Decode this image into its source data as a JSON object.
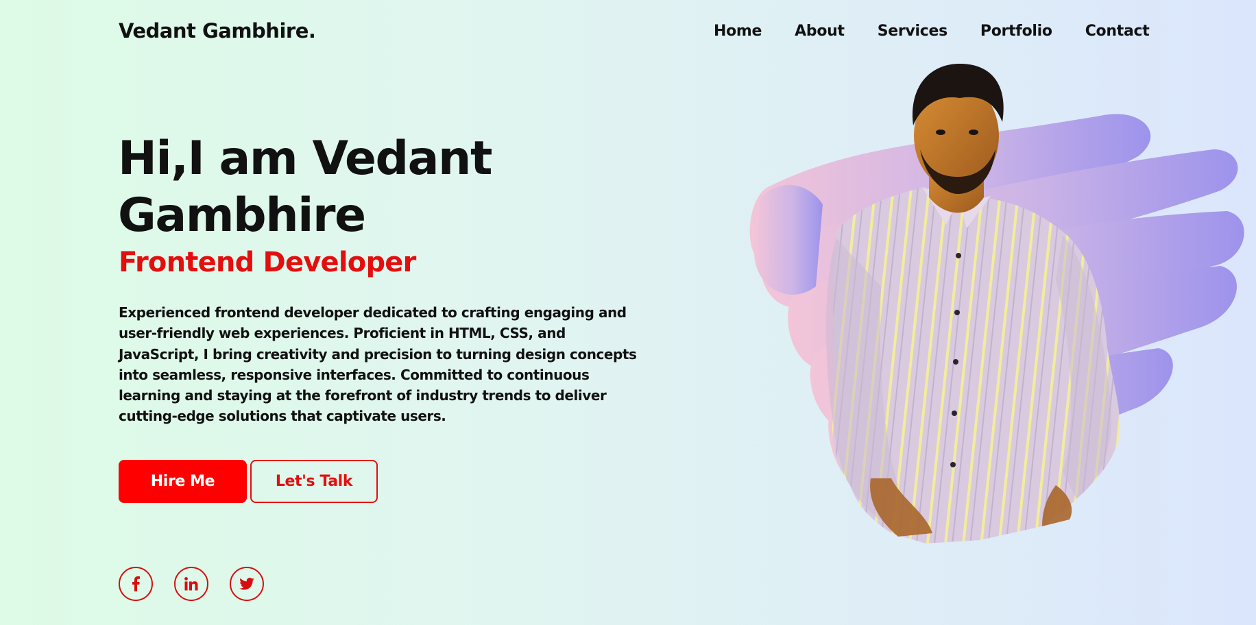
{
  "header": {
    "logo": "Vedant Gambhire.",
    "nav": [
      "Home",
      "About",
      "Services",
      "Portfolio",
      "Contact"
    ]
  },
  "hero": {
    "title": "Hi,I am Vedant Gambhire",
    "role": "Frontend Developer",
    "description": "Experienced frontend developer dedicated to crafting engaging and user-friendly web experiences. Proficient in HTML, CSS, and JavaScript, I bring creativity and precision to turning design concepts into seamless, responsive interfaces. Committed to continuous learning and staying at the forefront of industry trends to deliver cutting-edge solutions that captivate users.",
    "hire_button": "Hire Me",
    "talk_button": "Let's Talk"
  },
  "socials": [
    {
      "icon": "facebook-icon"
    },
    {
      "icon": "linkedin-icon"
    },
    {
      "icon": "twitter-icon"
    }
  ],
  "colors": {
    "accent": "#fe0000",
    "accent_text": "#e40e0e",
    "brush_start": "#f3c2d6",
    "brush_end": "#9b8fec",
    "shirt": "#d8c9dc",
    "stripes": "#f3ec9a",
    "skin": "#c47a2c",
    "hair": "#1c1410"
  }
}
